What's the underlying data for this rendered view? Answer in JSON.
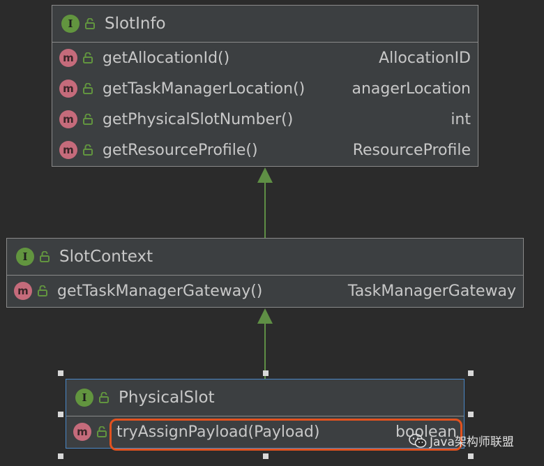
{
  "interfaces": [
    {
      "name": "SlotInfo",
      "badge": "I",
      "methods": [
        {
          "badge": "m",
          "name": "getAllocationId()",
          "type": "AllocationID"
        },
        {
          "badge": "m",
          "name": "getTaskManagerLocation()",
          "type": "anagerLocation"
        },
        {
          "badge": "m",
          "name": "getPhysicalSlotNumber()",
          "type": "int"
        },
        {
          "badge": "m",
          "name": "getResourceProfile()",
          "type": "ResourceProfile"
        }
      ]
    },
    {
      "name": "SlotContext",
      "badge": "I",
      "methods": [
        {
          "badge": "m",
          "name": "getTaskManagerGateway()",
          "type": "TaskManagerGateway"
        }
      ]
    },
    {
      "name": "PhysicalSlot",
      "badge": "I",
      "methods": [
        {
          "badge": "m",
          "name": "tryAssignPayload(Payload)",
          "type": "boolean"
        }
      ]
    }
  ],
  "watermark": {
    "text": "Java架构师联盟"
  },
  "colors": {
    "background": "#2b2b2b",
    "box": "#3c3f41",
    "interface_badge": "#62953f",
    "method_badge": "#c56b7b",
    "arrow": "#5f8f45",
    "selection": "#4a88c7",
    "highlight": "#e2521f"
  },
  "icons": {
    "interface": "interface-icon",
    "method": "method-icon",
    "visibility": "unlock-icon",
    "watermark": "wechat-icon"
  }
}
